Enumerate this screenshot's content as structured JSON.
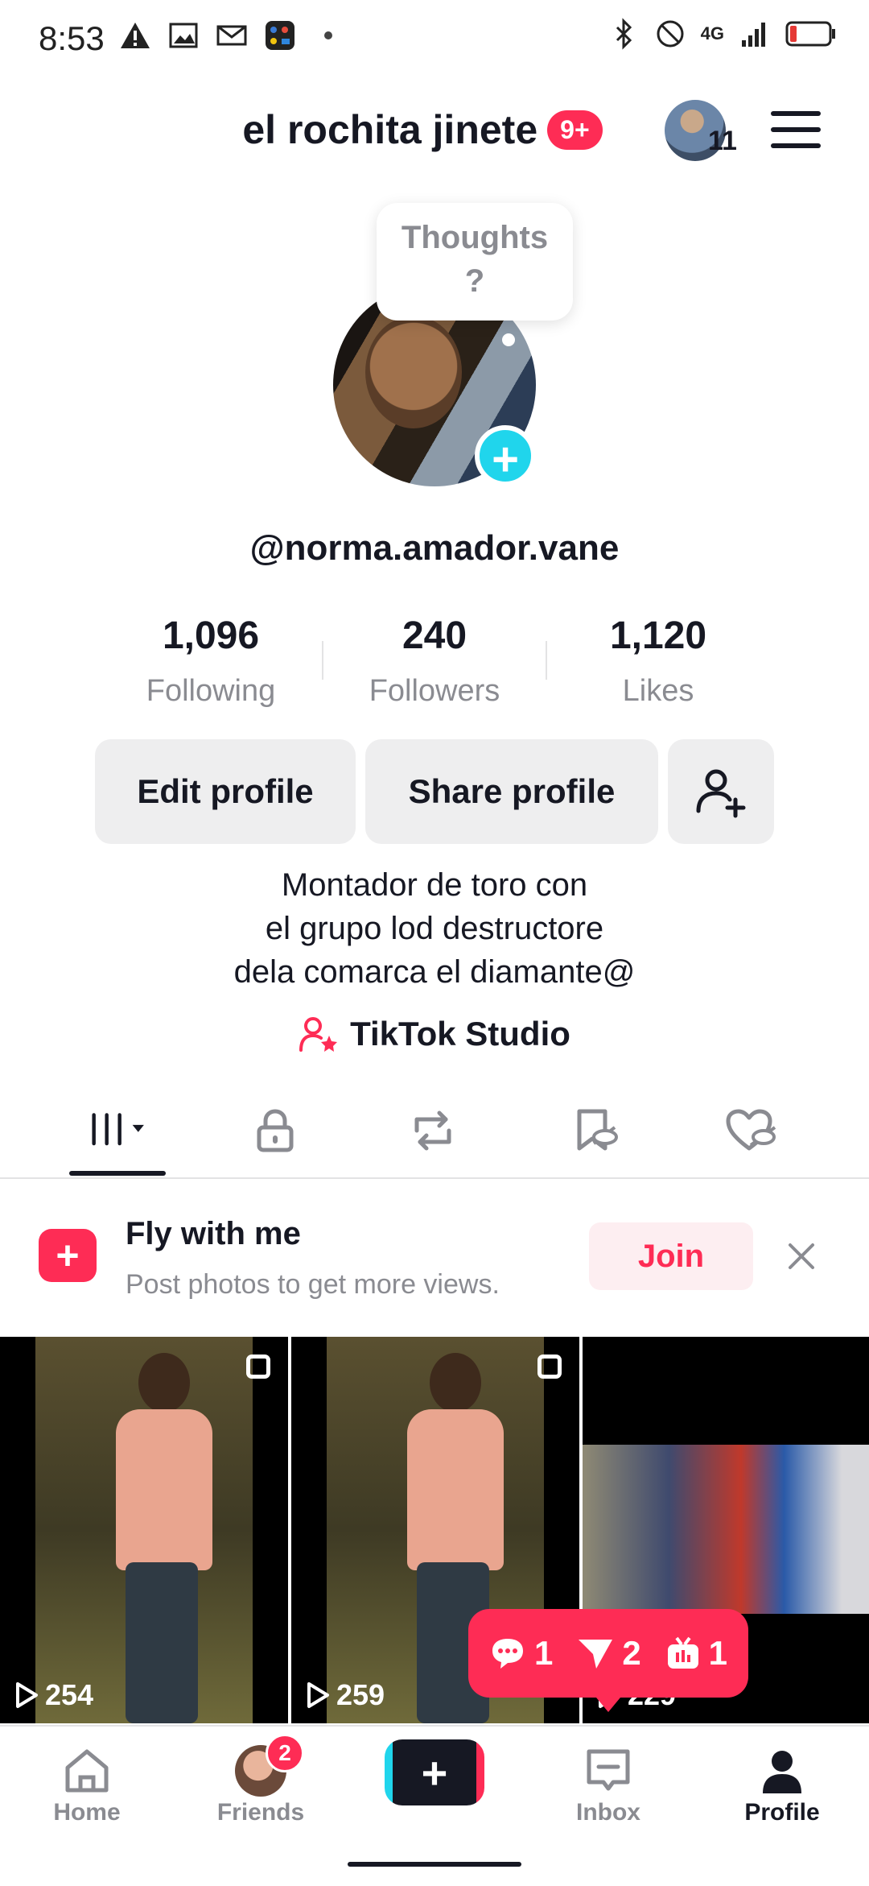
{
  "status_bar": {
    "time": "8:53",
    "network": "4G"
  },
  "header": {
    "title": "el rochita jinete",
    "badge": "9+",
    "account_count": "11"
  },
  "profile": {
    "thought_bubble": {
      "line1": "Thoughts",
      "line2": "?"
    },
    "username": "@norma.amador.vane",
    "stats": [
      {
        "value": "1,096",
        "label": "Following"
      },
      {
        "value": "240",
        "label": "Followers"
      },
      {
        "value": "1,120",
        "label": "Likes"
      }
    ],
    "buttons": {
      "edit": "Edit profile",
      "share": "Share profile"
    },
    "bio": [
      "Montador de toro con",
      "el grupo lod destructore",
      "dela comarca el diamante@"
    ],
    "studio_label": "TikTok Studio"
  },
  "banner": {
    "title": "Fly with me",
    "subtitle": "Post photos to get more views.",
    "join": "Join"
  },
  "videos": [
    {
      "views": "254"
    },
    {
      "views": "259"
    },
    {
      "views": "229"
    }
  ],
  "notification": {
    "comments": "1",
    "shares": "2",
    "live": "1"
  },
  "nav": {
    "home": "Home",
    "friends": "Friends",
    "friends_badge": "2",
    "create": "+",
    "inbox": "Inbox",
    "profile": "Profile"
  },
  "colors": {
    "accent": "#fe2c55",
    "cyan": "#20d5ec",
    "text": "#161823",
    "muted": "#8a8b91"
  }
}
